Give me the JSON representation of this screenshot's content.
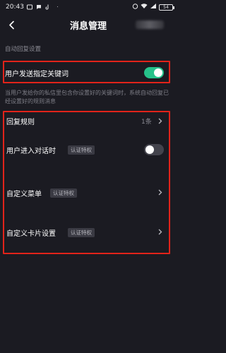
{
  "status_bar": {
    "time": "20:43",
    "battery": "54"
  },
  "nav": {
    "title": "消息管理"
  },
  "section_header": "自动回复设置",
  "keyword_row": {
    "label": "用户发送指定关键词",
    "toggle_on": true
  },
  "description": "当用户发给你的私信里包含你设置好的关键词时，系统自动回复已经设置好的规则消息",
  "reply_rules": {
    "label": "回复规则",
    "count": "1条"
  },
  "enter_dialog": {
    "label": "用户进入对话时",
    "badge": "认证特权",
    "toggle_on": false
  },
  "custom_menu": {
    "label": "自定义菜单",
    "badge": "认证特权"
  },
  "custom_card": {
    "label": "自定义卡片设置",
    "badge": "认证特权"
  },
  "colors": {
    "background": "#1b1b22",
    "toggle_on": "#26c28a",
    "highlight": "#e2231a"
  }
}
